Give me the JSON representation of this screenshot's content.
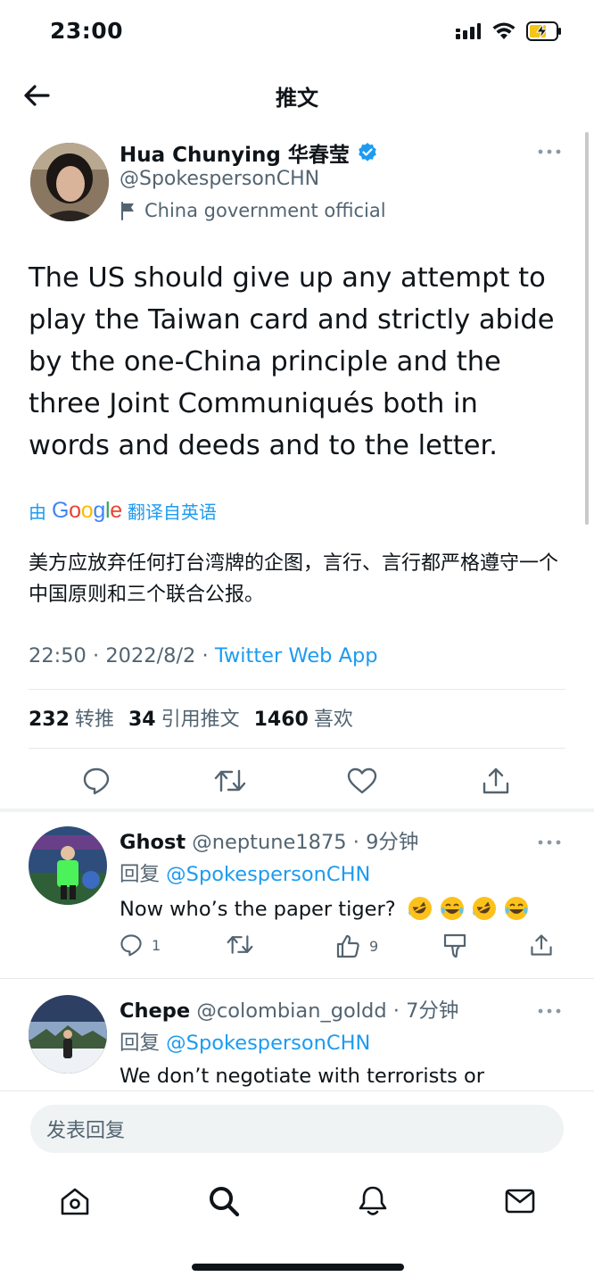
{
  "status_bar": {
    "time": "23:00",
    "icons": [
      "signal-icon",
      "wifi-icon",
      "battery-charging-icon"
    ],
    "battery_color": "#f5c518"
  },
  "header": {
    "title": "推文",
    "back_icon": "back-arrow-icon"
  },
  "tweet": {
    "author_name": "Hua Chunying 华春莹",
    "verified_icon": "verified-badge-icon",
    "verified_color": "#1d9bf0",
    "author_handle": "@SpokespersonCHN",
    "author_label": "China government official",
    "label_icon": "flag-icon",
    "text": "The US should give up any attempt to play the Taiwan card and strictly abide by the one-China principle and the three Joint Communiqués both in words and deeds and to the letter.",
    "translate_prefix": "由",
    "translate_brand": "Google",
    "translate_suffix": "翻译自英语",
    "translated_text": "美方应放弃任何打台湾牌的企图，言行、言行都严格遵守一个中国原则和三个联合公报。",
    "time": "22:50",
    "date": "2022/8/2",
    "separator": "·",
    "source": "Twitter Web App",
    "stats": {
      "retweets": "232",
      "retweets_label": "转推",
      "quotes": "34",
      "quotes_label": "引用推文",
      "likes": "1460",
      "likes_label": "喜欢"
    },
    "actions": [
      "reply-icon",
      "retweet-icon",
      "like-icon",
      "share-icon"
    ]
  },
  "replies": [
    {
      "name": "Ghost",
      "handle": "@neptune1875",
      "separator": "·",
      "time": "9分钟",
      "reply_prefix": "回复",
      "reply_to": "@SpokespersonCHN",
      "text": "Now who’s the paper tiger?",
      "emojis": [
        "rolling-laughing-emoji",
        "tears-of-joy-emoji",
        "rolling-laughing-emoji",
        "tears-of-joy-emoji"
      ],
      "reply_count": "1",
      "up_count": "9"
    },
    {
      "name": "Chepe",
      "handle": "@colombian_goldd",
      "separator": "·",
      "time": "7分钟",
      "reply_prefix": "回复",
      "reply_to": "@SpokespersonCHN",
      "text": "We don’t negotiate with terrorists or"
    }
  ],
  "composer": {
    "placeholder": "发表回复"
  },
  "tab_bar": [
    "home-icon",
    "search-icon",
    "notifications-bell-icon",
    "messages-mail-icon"
  ],
  "colors": {
    "accent": "#1d9bf0",
    "text_primary": "#0f1419",
    "text_secondary": "#536471"
  }
}
